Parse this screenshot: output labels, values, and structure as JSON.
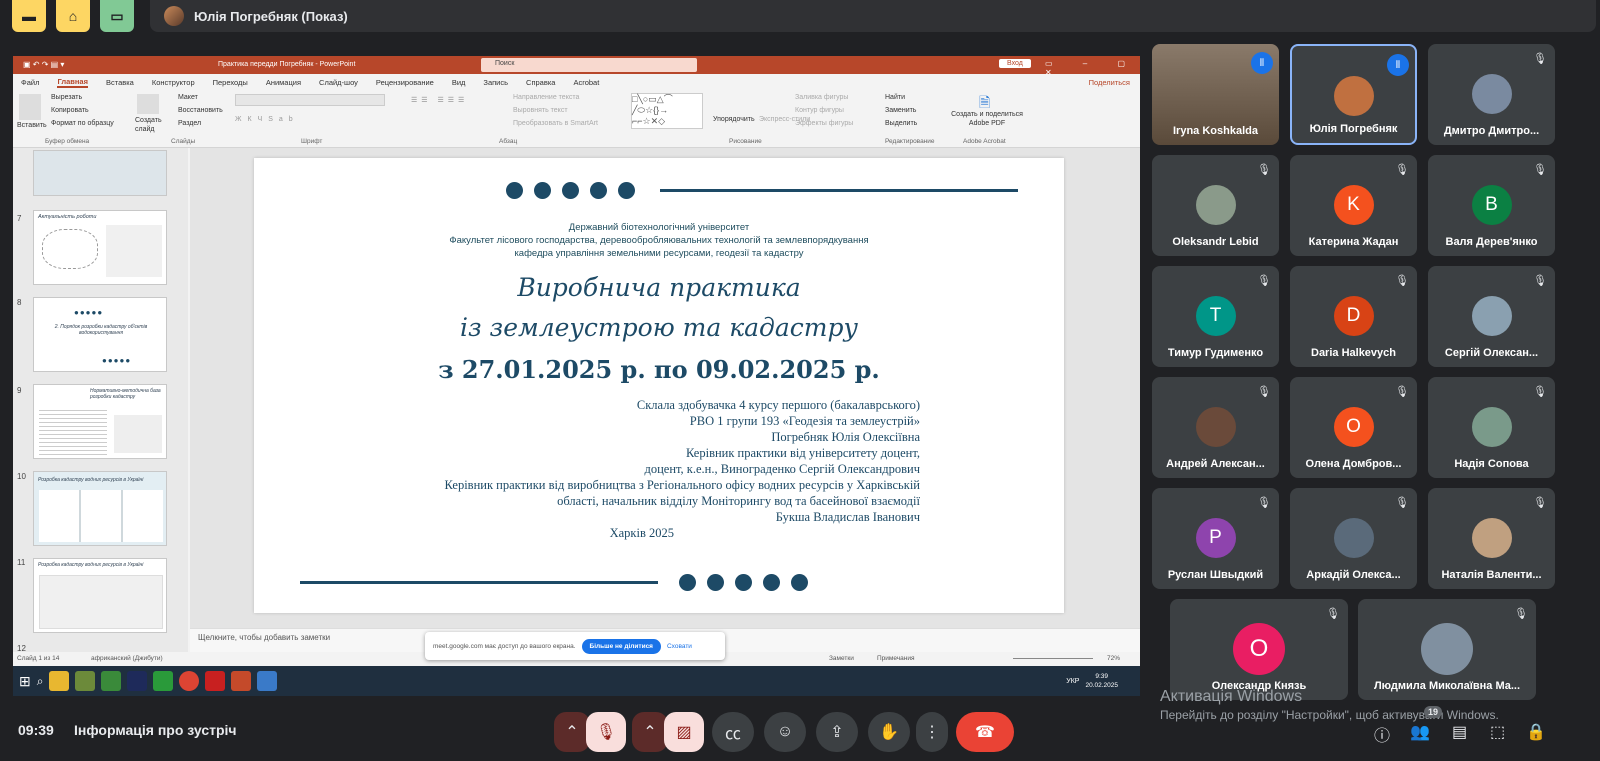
{
  "topbar": {
    "presenter_title": "Юлія Погребняк (Показ)"
  },
  "powerpoint": {
    "window_title": "Практика передди Погребняк - PowerPoint",
    "search_placeholder": "Поиск",
    "signin": "Вход",
    "menu": [
      "Файл",
      "Главная",
      "Вставка",
      "Конструктор",
      "Переходы",
      "Анимация",
      "Слайд-шоу",
      "Рецензирование",
      "Вид",
      "Запись",
      "Справка",
      "Acrobat"
    ],
    "share": "Поделиться",
    "ribbon": {
      "paste": "Вставить",
      "cut": "Вырезать",
      "copy": "Копировать",
      "format": "Формат по образцу",
      "clipboard": "Буфер обмена",
      "new_slide": "Создать слайд",
      "layout": "Макет",
      "reset": "Восстановить",
      "section": "Раздел",
      "slides": "Слайды",
      "font": "Шрифт",
      "paragraph": "Абзац",
      "text_dir": "Направление текста",
      "align_text": "Выровнять текст",
      "smartart": "Преобразовать в SmartArt",
      "arrange": "Упорядочить",
      "quick_styles": "Экспресс-стили",
      "drawing": "Рисование",
      "fill": "Заливка фигуры",
      "outline": "Контур фигуры",
      "effects": "Эффекты фигуры",
      "find": "Найти",
      "replace": "Заменить",
      "select": "Выделить",
      "editing": "Редактирование",
      "adobe_create": "Создать и поделиться Adobe PDF",
      "adobe": "Adobe Acrobat"
    },
    "thumb_numbers": [
      "7",
      "8",
      "9",
      "10",
      "11",
      "12"
    ],
    "thumb_titles": [
      "Актуальність роботи",
      "2. Порядок розробки кадастру об'єктів водокористування",
      "Нормативно-методична база розробки кадастру",
      "Розробка кадастру водних ресурсів в Україні",
      "Розробка кадастру водних ресурсів в Україні"
    ],
    "notes_placeholder": "Щелкните, чтобы добавить заметки",
    "status_left": "Слайд 1 из 14",
    "status_lang": "африканский (Джибути)",
    "status_notes": "Заметки",
    "status_comments": "Примечания",
    "zoom": "72%",
    "clock_time": "9:39",
    "clock_date": "20.02.2025",
    "lang": "УКР",
    "share_msg": "meet.google.com має доступ до вашого екрана.",
    "share_stop": "Більше не ділитися",
    "share_hide": "Сховати"
  },
  "slide": {
    "univ": "Державний біотехнологічний університет",
    "faculty": "Факультет лісового господарства, деревообробляювальних технологій та землевпорядкування",
    "dept": "кафедра управління земельними ресурсами, геодезії та кадастру",
    "title1": "Виробнича практика",
    "title2": "із землеустрою та кадастру",
    "title3": "з 27.01.2025 р. по 09.02.2025 р.",
    "lines": [
      "Склала здобувачка 4 курсу першого (бакалаврського)",
      "РВО 1 групи 193 «Геодезія та землеустрій»",
      "Погребняк Юлія Олексіївна",
      "Керівник практики від університету доцент,",
      "доцент, к.е.н., Винограденко Сергій  Олександрович",
      "Керівник практики від виробництва з Регіонального офісу водних ресурсів у Харківській",
      "області, начальник відділу Моніторингу вод та басейнової взаємодії",
      "Букша Владислав Іванович"
    ],
    "city": "Харків 2025"
  },
  "participants": [
    {
      "name": "Iryna Koshkalda",
      "initial": "",
      "color": "#6b5a4e"
    },
    {
      "name": "Юлія Погребняк",
      "initial": "",
      "color": "#c07040"
    },
    {
      "name": "Дмитро Дмитро...",
      "initial": "",
      "color": "#7a8aa0"
    },
    {
      "name": "Oleksandr Lebid",
      "initial": "",
      "color": "#8a9a8a"
    },
    {
      "name": "Катерина Жадан",
      "initial": "K",
      "color": "#f4511e"
    },
    {
      "name": "Валя Дерев'янко",
      "initial": "B",
      "color": "#0b8043"
    },
    {
      "name": "Тимур Гудименко",
      "initial": "T",
      "color": "#009688"
    },
    {
      "name": "Daria Halkevych",
      "initial": "D",
      "color": "#d84315"
    },
    {
      "name": "Сергій Олексан...",
      "initial": "",
      "color": "#8aa0b0"
    },
    {
      "name": "Андрей Алексан...",
      "initial": "",
      "color": "#6a4a3a"
    },
    {
      "name": "Олена Домбров...",
      "initial": "O",
      "color": "#f4511e"
    },
    {
      "name": "Надія Сопова",
      "initial": "",
      "color": "#7a9a8a"
    },
    {
      "name": "Руслан Швыдкий",
      "initial": "P",
      "color": "#8e44ad"
    },
    {
      "name": "Аркадій Олекса...",
      "initial": "",
      "color": "#5a6a7a"
    },
    {
      "name": "Наталія Валенти...",
      "initial": "",
      "color": "#c0a080"
    },
    {
      "name": "Олександр Князь",
      "initial": "O",
      "color": "#e91e63"
    },
    {
      "name": "Людмила Миколаївна Ма...",
      "initial": "",
      "color": "#8090a0"
    }
  ],
  "bottom": {
    "time": "09:39",
    "info": "Інформація про зустріч",
    "people_count": "19",
    "activate1": "Активація Windows",
    "activate2": "Перейдіть до розділу \"Настройки\", щоб активувати Windows."
  }
}
